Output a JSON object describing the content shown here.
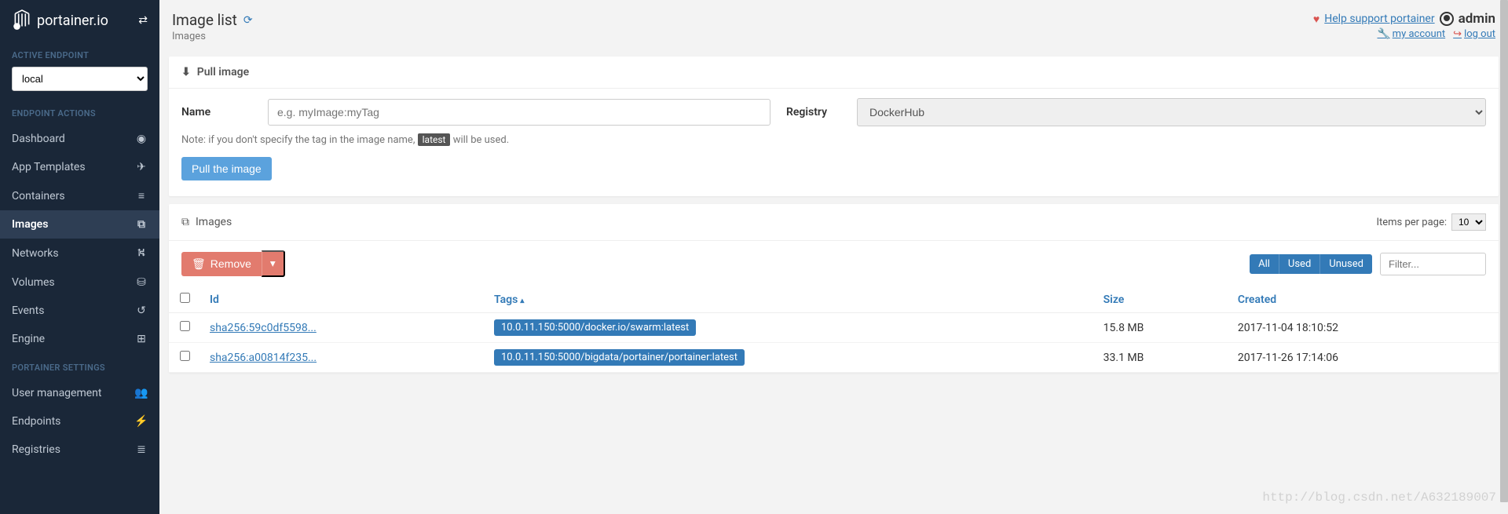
{
  "brand": "portainer.io",
  "sidebar": {
    "active_endpoint_label": "ACTIVE ENDPOINT",
    "endpoint_value": "local",
    "endpoint_actions_label": "ENDPOINT ACTIONS",
    "items": [
      {
        "label": "Dashboard",
        "icon": "dashboard-icon"
      },
      {
        "label": "App Templates",
        "icon": "rocket-icon"
      },
      {
        "label": "Containers",
        "icon": "list-icon"
      },
      {
        "label": "Images",
        "icon": "clone-icon",
        "active": true
      },
      {
        "label": "Networks",
        "icon": "sitemap-icon"
      },
      {
        "label": "Volumes",
        "icon": "database-icon"
      },
      {
        "label": "Events",
        "icon": "history-icon"
      },
      {
        "label": "Engine",
        "icon": "grid-icon"
      }
    ],
    "settings_label": "PORTAINER SETTINGS",
    "settings_items": [
      {
        "label": "User management",
        "icon": "users-icon"
      },
      {
        "label": "Endpoints",
        "icon": "plug-icon"
      },
      {
        "label": "Registries",
        "icon": "stack-icon"
      }
    ]
  },
  "header": {
    "title": "Image list",
    "subtitle": "Images",
    "support": "Help support portainer",
    "user": "admin",
    "my_account": "my account",
    "logout": "log out"
  },
  "pull_panel": {
    "title": "Pull image",
    "name_label": "Name",
    "name_placeholder": "e.g. myImage:myTag",
    "registry_label": "Registry",
    "registry_value": "DockerHub",
    "note_before": "Note: if you don't specify the tag in the image name,",
    "note_badge": "latest",
    "note_after": "will be used.",
    "pull_button": "Pull the image"
  },
  "images_panel": {
    "title": "Images",
    "items_per_page_label": "Items per page:",
    "items_per_page_value": "10",
    "remove_button": "Remove",
    "filters": {
      "all": "All",
      "used": "Used",
      "unused": "Unused"
    },
    "filter_placeholder": "Filter...",
    "columns": {
      "id": "Id",
      "tags": "Tags",
      "size": "Size",
      "created": "Created"
    },
    "rows": [
      {
        "id": "sha256:59c0df5598...",
        "tag": "10.0.11.150:5000/docker.io/swarm:latest",
        "size": "15.8 MB",
        "created": "2017-11-04 18:10:52"
      },
      {
        "id": "sha256:a00814f235...",
        "tag": "10.0.11.150:5000/bigdata/portainer/portainer:latest",
        "size": "33.1 MB",
        "created": "2017-11-26 17:14:06"
      }
    ]
  },
  "watermark": "http://blog.csdn.net/A632189007"
}
